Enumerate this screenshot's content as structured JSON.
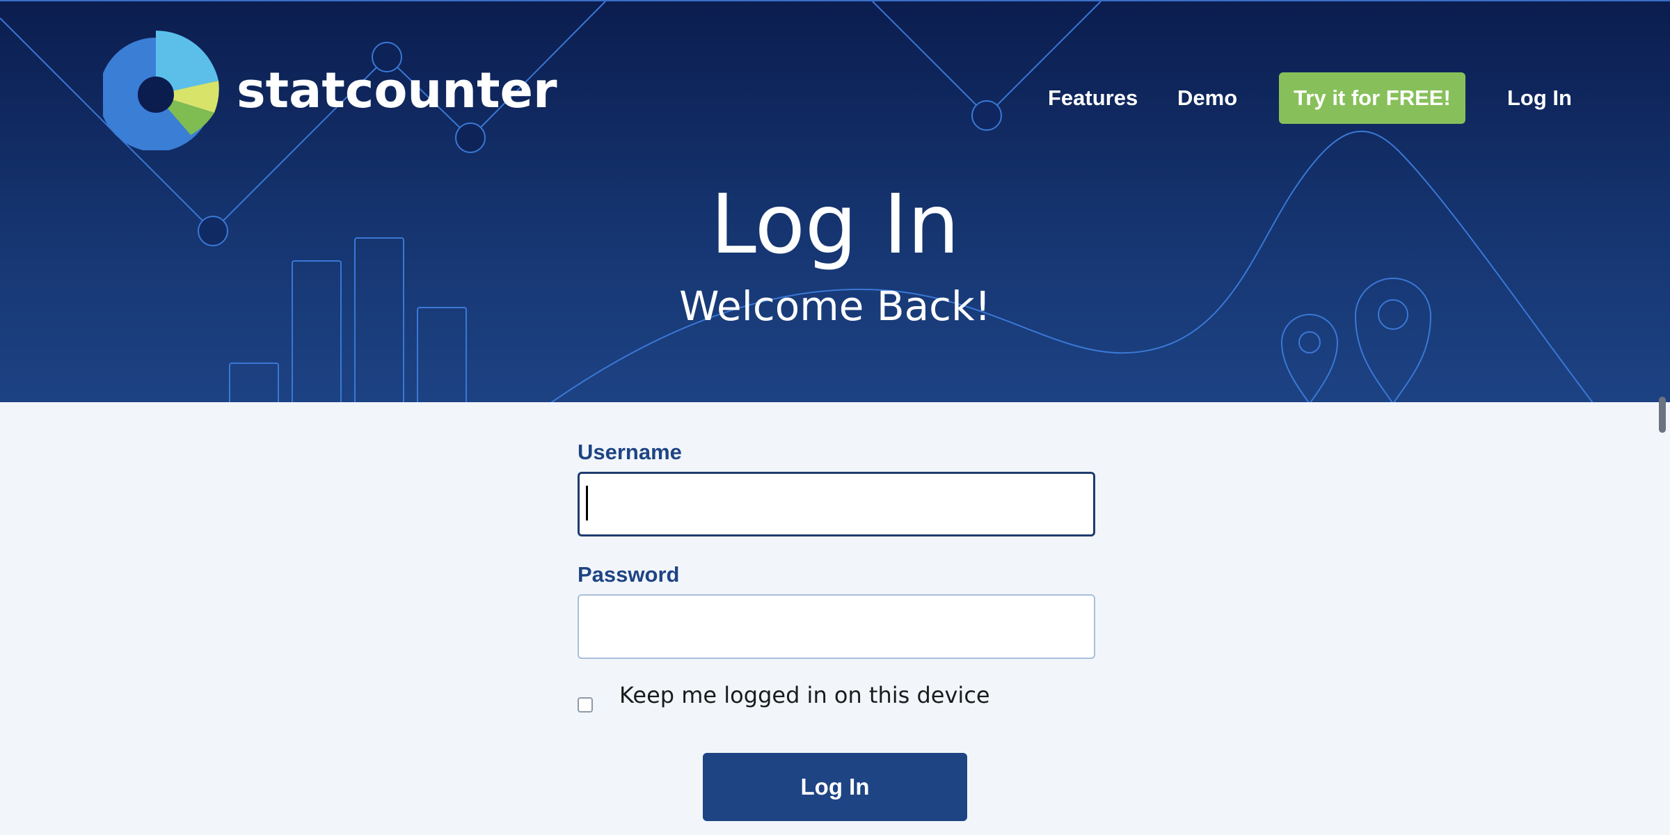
{
  "brand": {
    "name": "statcounter"
  },
  "nav": {
    "features": "Features",
    "demo": "Demo",
    "cta": "Try it for FREE!",
    "login": "Log In"
  },
  "hero": {
    "title": "Log In",
    "subtitle": "Welcome Back!"
  },
  "form": {
    "username_label": "Username",
    "username_value": "",
    "password_label": "Password",
    "password_value": "",
    "remember_label": "Keep me logged in on this device",
    "remember_checked": false,
    "submit_label": "Log In"
  },
  "colors": {
    "hero_top": "#0b1d4f",
    "hero_bottom": "#1d4283",
    "accent_green": "#87c05a",
    "primary_blue": "#1e4483",
    "page_bg": "#f2f6fb"
  },
  "icons": [
    "statcounter-logo-icon",
    "map-pin-icon"
  ]
}
